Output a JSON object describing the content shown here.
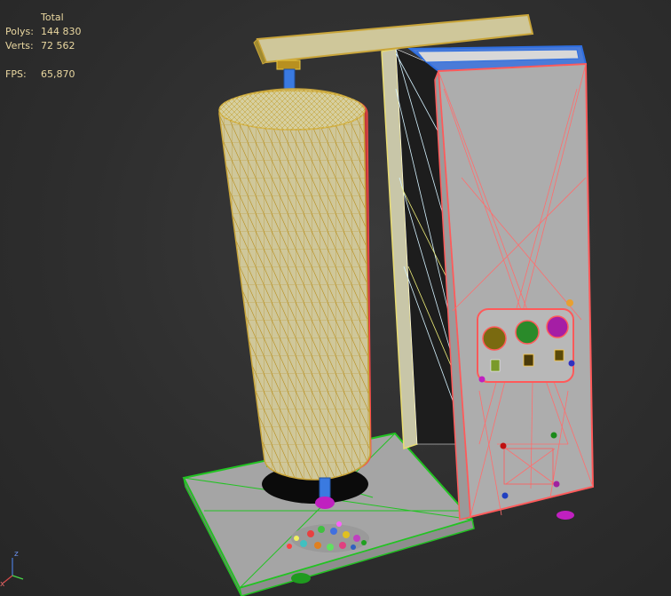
{
  "stats": {
    "header": "Total",
    "polys_label": "Polys:",
    "polys_value": "144 830",
    "verts_label": "Verts:",
    "verts_value": "72 562",
    "fps_label": "FPS:",
    "fps_value": "65,870"
  },
  "gizmo": {
    "z_label": "z",
    "x_label": "x"
  },
  "colors": {
    "viewport_bg": "#2e2e2e",
    "stats_text": "#e9d7a0",
    "roll_wire": "#c9a53a",
    "cabinet_wire": "#ff5a5a",
    "base_wire": "#22c322",
    "top_wire": "#2e6ee0",
    "surface_gray": "#a9a9a9"
  }
}
